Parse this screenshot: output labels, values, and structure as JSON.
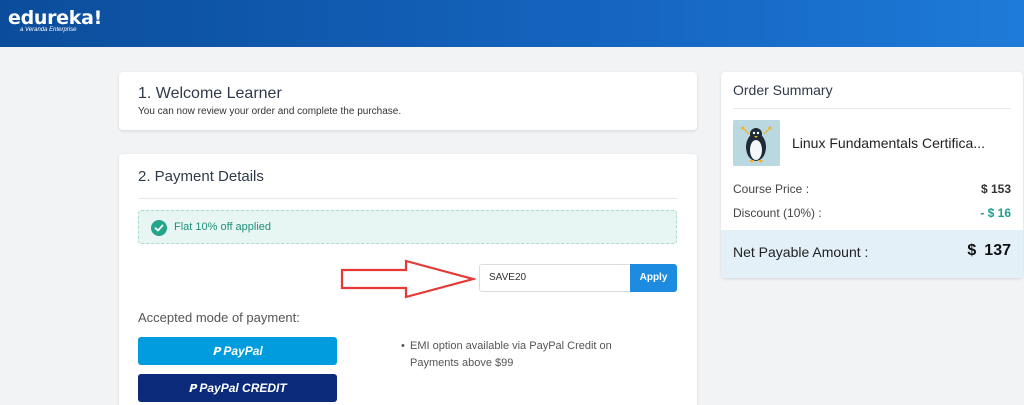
{
  "header": {
    "logo": "edureka!",
    "tagline": "a Veranda Enterprise"
  },
  "welcome": {
    "title": "1. Welcome Learner",
    "subtitle": "You can now review your order and complete the purchase."
  },
  "payment": {
    "title": "2. Payment Details",
    "coupon_message": "Flat 10% off applied",
    "coupon_value": "SAVE20",
    "apply_label": "Apply",
    "accepted_label": "Accepted mode of payment:",
    "paypal_label": "PayPal",
    "paypal_credit_label": "PayPal CREDIT",
    "emi_note": "EMI option available via PayPal Credit on Payments above $99",
    "annotation_arrow_color": "#e53935"
  },
  "summary": {
    "title": "Order Summary",
    "course_name": "Linux Fundamentals Certifica...",
    "course_price_label": "Course Price :",
    "course_price_value": "$ 153",
    "discount_label": "Discount (10%) :",
    "discount_value": "- $ 16",
    "net_label": "Net Payable Amount :",
    "net_currency": "$",
    "net_value": "137"
  },
  "colors": {
    "brand": "#1565c0",
    "accent": "#1c8be0",
    "success": "#23a48b",
    "paypal": "#009cde",
    "paypal_credit": "#0b2a7a"
  }
}
